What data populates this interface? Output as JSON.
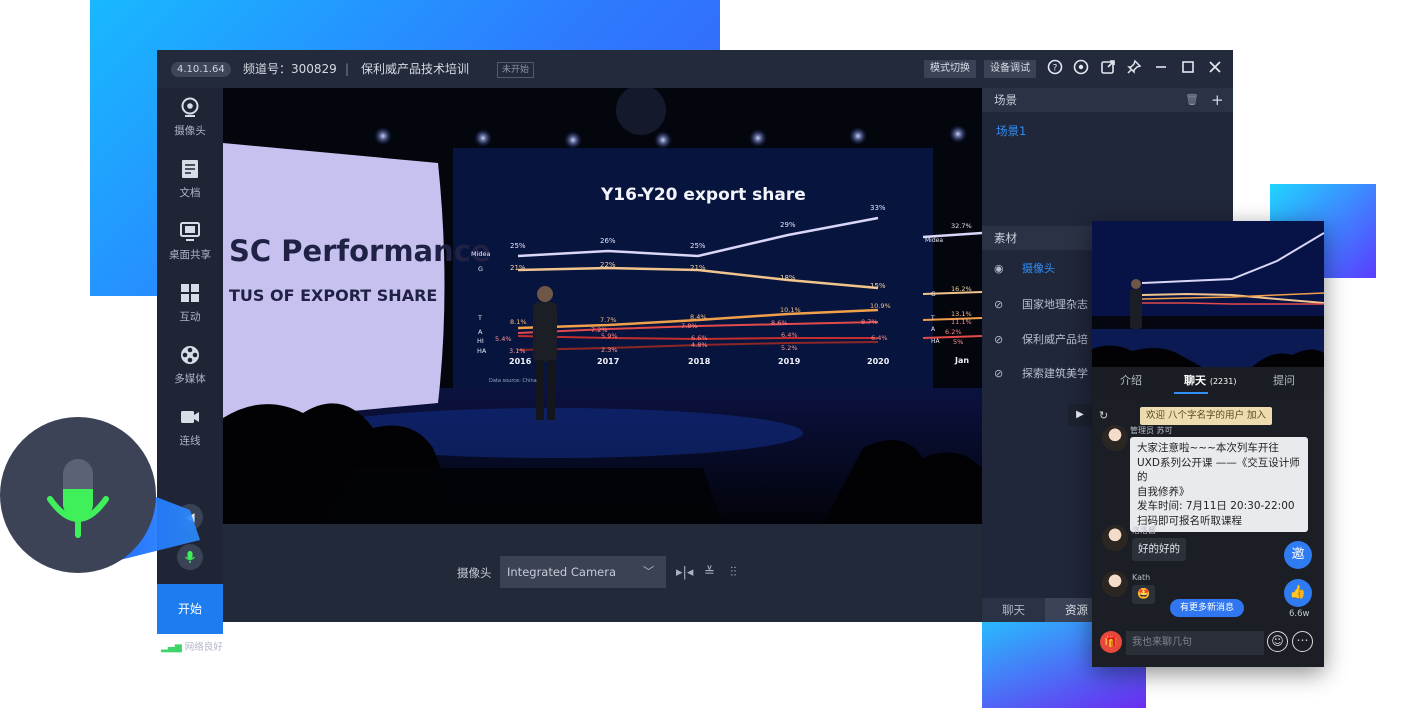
{
  "window": {
    "version": "4.10.1.64",
    "channel": "频道号：300829",
    "separator": "|",
    "course_title": "保利威产品技术培训",
    "status": "未开始",
    "mode_button": "模式切换",
    "device_button": "设备调试",
    "icons": [
      "help-icon",
      "settings-icon",
      "share-icon",
      "pin-icon",
      "minimize-icon",
      "maximize-icon",
      "close-icon"
    ]
  },
  "sidebar": {
    "items": [
      {
        "label": "摄像头",
        "icon": "webcam-icon"
      },
      {
        "label": "文档",
        "icon": "document-icon"
      },
      {
        "label": "桌面共享",
        "icon": "screen-share-icon"
      },
      {
        "label": "互动",
        "icon": "grid-icon"
      },
      {
        "label": "多媒体",
        "icon": "film-icon"
      },
      {
        "label": "连线",
        "icon": "video-call-icon"
      }
    ],
    "start_label": "开始",
    "network_label": "网络良好"
  },
  "stage": {
    "slide_title": "SC Performance",
    "slide_subtitle": "TUS OF EXPORT SHARE",
    "chart_title": "Y16-Y20 export share",
    "series_labels": [
      "Midea",
      "G",
      "T",
      "A",
      "HI",
      "HA"
    ],
    "values_top": [
      "25%",
      "26%",
      "25%",
      "29%",
      "33%"
    ],
    "values_second": [
      "21%",
      "22%",
      "21%",
      "18%",
      "15%"
    ],
    "values_t": [
      "8.1%",
      "7.7%",
      "8.4%",
      "10.1%",
      "10.9%"
    ],
    "values_mid": [
      "7.2%",
      "7.8%",
      "8.6%",
      "8.7%"
    ],
    "values_low": [
      "5.9%",
      "6.6%",
      "6.4%",
      "6.4%"
    ],
    "values_bottom": [
      "5.4%",
      "4.8%",
      "5.2%"
    ],
    "hi_value": "3.1%",
    "ha_value": "2.3%",
    "years": [
      "2016",
      "2017",
      "2018",
      "2019",
      "2020"
    ],
    "source_note": "Data source: China",
    "right_screen_values": [
      "32.7%",
      "16.2%",
      "13.1%",
      "11.1%",
      "6.2%",
      "5%"
    ],
    "right_screen_labels": [
      "Midea",
      "G",
      "T",
      "A",
      "HA",
      "Jan"
    ]
  },
  "controls": {
    "camera_label": "摄像头",
    "camera_value": "Integrated Camera",
    "icons": [
      "mirror-horizontal-icon",
      "mirror-vertical-icon",
      "adjust-icon"
    ]
  },
  "right_panel": {
    "scene_header": "场景",
    "scene_item": "场景1",
    "material_header": "素材",
    "materials": [
      {
        "label": "摄像头",
        "icon": "eye-icon"
      },
      {
        "label": "国家地理杂志",
        "icon": "eye-hidden-icon"
      },
      {
        "label": "保利威产品培",
        "icon": "eye-hidden-icon"
      },
      {
        "label": "探索建筑美学",
        "icon": "eye-hidden-icon"
      }
    ],
    "tabs": [
      "聊天",
      "资源"
    ]
  },
  "mobile": {
    "tabs": [
      "介绍",
      "聊天",
      "提问"
    ],
    "chat_count": "(2231)",
    "welcome": "欢迎 八个字名字的用户 加入",
    "messages": [
      {
        "user": "管理员 苏可",
        "text": [
          "大家注意啦~~~本次列车开往",
          "UXD系列公开课 ——《交互设计师的",
          "自我修养》",
          "发车时间: 7月11日 20:30-22:00",
          "扫码即可报名听取课程"
        ]
      },
      {
        "user": "洛洛酱",
        "text": [
          "好的好的"
        ]
      },
      {
        "user": "Kath",
        "text": [
          "🤩"
        ]
      }
    ],
    "more_messages": "有更多新消息",
    "invite_label": "邀",
    "like_count": "6.6w",
    "input_placeholder": "我也来聊几句"
  },
  "colors": {
    "accent_blue": "#1d7cf0",
    "mic_green": "#3ff05a",
    "window_bg": "#1d2334"
  }
}
